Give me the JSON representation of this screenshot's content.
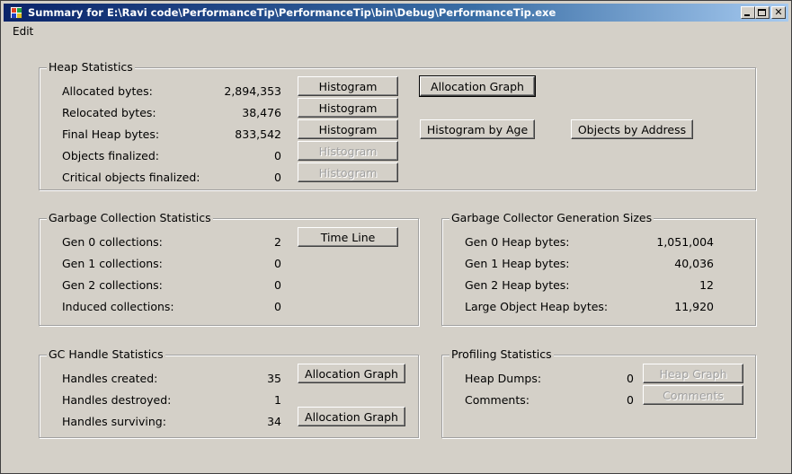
{
  "window": {
    "title": "Summary for E:\\Ravi code\\PerformanceTip\\PerformanceTip\\bin\\Debug\\PerformanceTip.exe"
  },
  "menu": {
    "edit": "Edit"
  },
  "heap": {
    "title": "Heap Statistics",
    "rows": [
      {
        "label": "Allocated bytes:",
        "value": "2,894,353",
        "button": "Histogram"
      },
      {
        "label": "Relocated bytes:",
        "value": "38,476",
        "button": "Histogram"
      },
      {
        "label": "Final Heap bytes:",
        "value": "833,542",
        "button": "Histogram"
      },
      {
        "label": "Objects finalized:",
        "value": "0",
        "button": "Histogram"
      },
      {
        "label": "Critical objects finalized:",
        "value": "0",
        "button": "Histogram"
      }
    ],
    "allocation_graph": "Allocation Graph",
    "histogram_by_age": "Histogram by Age",
    "objects_by_address": "Objects by Address"
  },
  "gc": {
    "title": "Garbage Collection Statistics",
    "rows": [
      {
        "label": "Gen 0 collections:",
        "value": "2"
      },
      {
        "label": "Gen 1 collections:",
        "value": "0"
      },
      {
        "label": "Gen 2 collections:",
        "value": "0"
      },
      {
        "label": "Induced collections:",
        "value": "0"
      }
    ],
    "time_line": "Time Line"
  },
  "gen_sizes": {
    "title": "Garbage Collector Generation Sizes",
    "rows": [
      {
        "label": "Gen 0 Heap bytes:",
        "value": "1,051,004"
      },
      {
        "label": "Gen 1 Heap bytes:",
        "value": "40,036"
      },
      {
        "label": "Gen 2 Heap bytes:",
        "value": "12"
      },
      {
        "label": "Large Object Heap bytes:",
        "value": "11,920"
      }
    ]
  },
  "handles": {
    "title": "GC Handle Statistics",
    "rows": [
      {
        "label": "Handles created:",
        "value": "35"
      },
      {
        "label": "Handles destroyed:",
        "value": "1"
      },
      {
        "label": "Handles surviving:",
        "value": "34"
      }
    ],
    "allocation_graph_1": "Allocation Graph",
    "allocation_graph_2": "Allocation Graph"
  },
  "profiling": {
    "title": "Profiling Statistics",
    "rows": [
      {
        "label": "Heap Dumps:",
        "value": "0",
        "button": "Heap Graph"
      },
      {
        "label": "Comments:",
        "value": "0",
        "button": "Comments"
      }
    ]
  }
}
